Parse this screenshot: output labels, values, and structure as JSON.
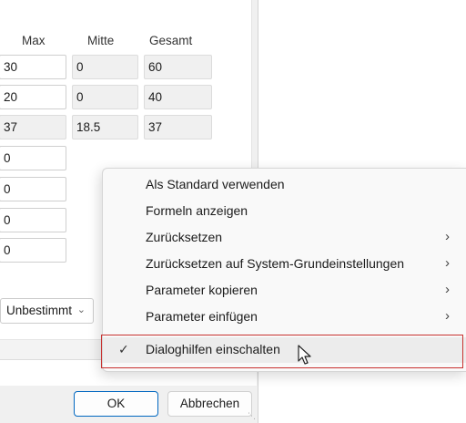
{
  "columns": {
    "max": "Max",
    "mitte": "Mitte",
    "gesamt": "Gesamt"
  },
  "rows": [
    {
      "max": "30",
      "mitte": "0",
      "gesamt": "60"
    },
    {
      "max": "20",
      "mitte": "0",
      "gesamt": "40"
    },
    {
      "max": "37",
      "mitte": "18.5",
      "gesamt": "37"
    }
  ],
  "lower_fields": [
    "0",
    "0",
    "0",
    "0"
  ],
  "combo": {
    "value": "Unbestimmt"
  },
  "buttons": {
    "ok": "OK",
    "cancel": "Abbrechen"
  },
  "context_menu": {
    "items": [
      {
        "label": "Als Standard verwenden",
        "submenu": false
      },
      {
        "label": "Formeln anzeigen",
        "submenu": false
      },
      {
        "label": "Zurücksetzen",
        "submenu": true
      },
      {
        "label": "Zurücksetzen auf System-Grundeinstellungen",
        "submenu": true
      },
      {
        "label": "Parameter kopieren",
        "submenu": true
      },
      {
        "label": "Parameter einfügen",
        "submenu": true
      },
      {
        "label": "Dialoghilfen einschalten",
        "submenu": false,
        "checked": true,
        "highlighted": true
      }
    ],
    "check_glyph": "✓",
    "submenu_glyph": "›"
  },
  "colors": {
    "accent": "#0067c0",
    "highlight_border": "#c8312f",
    "menu_bg": "#f9f9f9",
    "dialog_bg": "#f0f0f0"
  }
}
